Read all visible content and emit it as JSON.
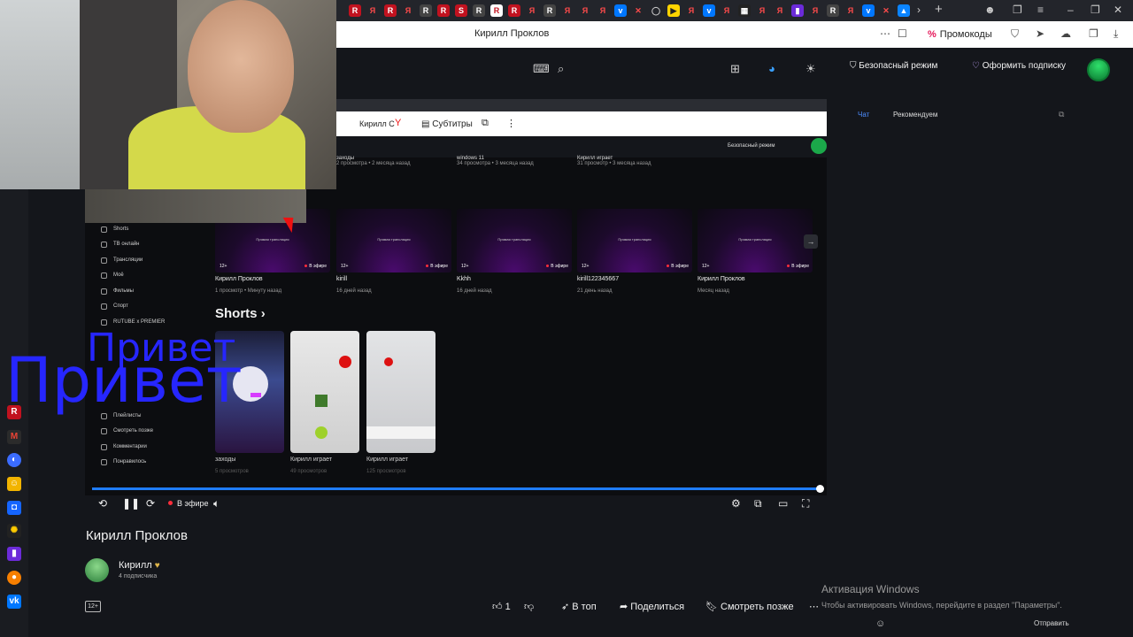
{
  "browser": {
    "page_title": "Кирилл Проклов",
    "promo_label": "Промокоды"
  },
  "header": {
    "safe_mode": "Безопасный режим",
    "subscribe": "Оформить подписку"
  },
  "inner_screen": {
    "tab_label": "Кирилл С",
    "subtitles_label": "Субтитры",
    "top_videos": [
      {
        "title": "заходы",
        "meta": "2 просмотра • 2 месяца назад"
      },
      {
        "title": "windows 11",
        "meta": "34 просмотра • 3 месяца назад"
      },
      {
        "title": "Кирилл играет",
        "meta": "31 просмотр • 3 месяца назад"
      }
    ],
    "sidebar": [
      "Shorts",
      "ТВ онлайн",
      "Трансляции",
      "Моё",
      "Фильмы",
      "Спорт",
      "RUTUBE x PREMIER"
    ],
    "sidebar_lower": [
      "Плейлисты",
      "Смотреть позже",
      "Комментарии",
      "Понравилось"
    ],
    "thumb_text": "Прямая трансляция",
    "thumb_age": "12+",
    "thumb_live": "В эфире",
    "live_videos": [
      {
        "title": "Кирилл Проклов",
        "meta": "1 просмотр • Минуту назад"
      },
      {
        "title": "kirill",
        "meta": "16 дней назад"
      },
      {
        "title": "Kkhh",
        "meta": "16 дней назад"
      },
      {
        "title": "kirill122345667",
        "meta": "21 день назад"
      },
      {
        "title": "Кирилл Проклов",
        "meta": "Месяц назад"
      }
    ],
    "shorts_heading": "Shorts",
    "shorts": [
      {
        "title": "заходы",
        "meta": "5 просмотров"
      },
      {
        "title": "Кирилл играет",
        "meta": "49 просмотров"
      },
      {
        "title": "Кирилл играет",
        "meta": "125 просмотров"
      }
    ],
    "overlay_text": "Привет"
  },
  "player": {
    "progress": 1.0,
    "live_label": "В эфире"
  },
  "video": {
    "title": "Кирилл Проклов",
    "channel_name": "Кирилл",
    "subscribers": "4 подписчика",
    "age_rating": "12+",
    "likes": "1",
    "to_top": "В топ",
    "share": "Поделиться",
    "watch_later": "Смотреть позже"
  },
  "chat": {
    "tab_chat": "Чат",
    "tab_recommended": "Рекомендуем",
    "send": "Отправить"
  },
  "windows": {
    "activation_title": "Активация Windows",
    "activation_text": "Чтобы активировать Windows, перейдите в раздел \"Параметры\"."
  },
  "colors": {
    "accent_blue": "#1f7cff",
    "live_red": "#ff2d3b",
    "overlay_blue": "#2626ff"
  }
}
